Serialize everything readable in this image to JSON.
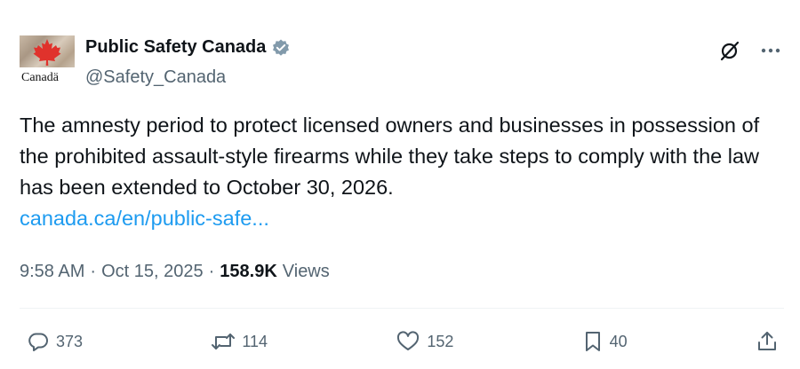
{
  "account": {
    "display_name": "Public Safety Canada",
    "handle": "@Safety_Canada",
    "avatar_wordmark": "Canadä",
    "verified_color": "#829aab"
  },
  "tweet": {
    "text": "The amnesty period to protect licensed owners and businesses in possession of the prohibited assault-style firearms while they take steps to comply with the law has been extended to October 30, 2026.",
    "link": "canada.ca/en/public-safe..."
  },
  "meta": {
    "time": "9:58 AM",
    "date": "Oct 15, 2025",
    "views_count": "158.9K",
    "views_label": "Views"
  },
  "actions": {
    "replies": "373",
    "reposts": "114",
    "likes": "152",
    "bookmarks": "40"
  },
  "colors": {
    "link": "#1d9bf0",
    "secondary_text": "#536471",
    "primary_text": "#0f1419",
    "maple_leaf": "#e0322c"
  },
  "icons": [
    "grok-icon",
    "more-icon",
    "reply-icon",
    "repost-icon",
    "like-icon",
    "bookmark-icon",
    "share-icon",
    "verified-badge-icon",
    "maple-leaf-icon"
  ]
}
